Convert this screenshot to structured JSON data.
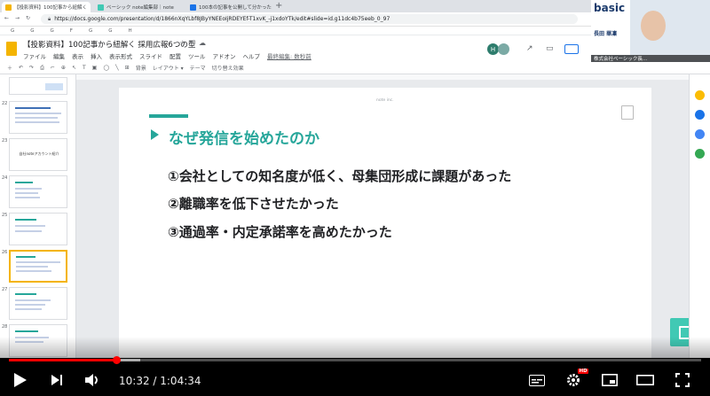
{
  "browser": {
    "tabs": [
      {
        "title": "【投影資料】100記事から紐解く",
        "icon": "docs-icon",
        "color": "#f4b400"
      },
      {
        "title": "ベーシック note編集部｜note",
        "icon": "note-icon",
        "color": "#41c9b4"
      },
      {
        "title": "100本の記事を公開して分かった…",
        "icon": "hatena-icon",
        "color": "#1a73e8"
      }
    ],
    "new_tab": "+",
    "url": "https://docs.google.com/presentation/d/1866nXqYLbf8JByYNEEoIjRDEYEf-T1xvK_-j1xdoYTk/edit#slide=id.g11dc4b75eeb_0_97",
    "bookmarks": [
      "G",
      "G",
      "G",
      "F",
      "G",
      "G",
      "H"
    ]
  },
  "docs": {
    "title": "【投影資料】100記事から紐解く 採用広報6つの型",
    "menus": [
      "ファイル",
      "編集",
      "表示",
      "挿入",
      "表示形式",
      "スライド",
      "配置",
      "ツール",
      "アドオン",
      "ヘルプ"
    ],
    "last_edit": "最終編集: 数秒前",
    "toolbar": [
      "背景",
      "レイアウト ▾",
      "テーマ",
      "切り替え効果"
    ],
    "avatar_initial": "H"
  },
  "thumbnails": [
    {
      "num": "22",
      "text": ""
    },
    {
      "num": "23",
      "text": "自社noteアカウント紹介"
    },
    {
      "num": "24",
      "text": ""
    },
    {
      "num": "25",
      "text": ""
    },
    {
      "num": "26",
      "text": ""
    },
    {
      "num": "27",
      "text": ""
    },
    {
      "num": "28",
      "text": ""
    }
  ],
  "slide": {
    "header": "note inc.",
    "title": "なぜ発信を始めたのか",
    "points": [
      "①会社としての知名度が低く、母集団形成に課題があった",
      "②離職率を低下させたかった",
      "③通過率・内定承諾率を高めたかった"
    ],
    "accent": "#26a69a"
  },
  "webcam": {
    "brand": "basic",
    "name": "長田 華凜",
    "company": "株式会社ベーシック長..."
  },
  "player": {
    "current_time": "10:32",
    "duration": "1:04:34",
    "time_display": "10:32 / 1:04:34",
    "progress": 0.157,
    "buffered": 0.19,
    "hd_badge": "HD"
  }
}
